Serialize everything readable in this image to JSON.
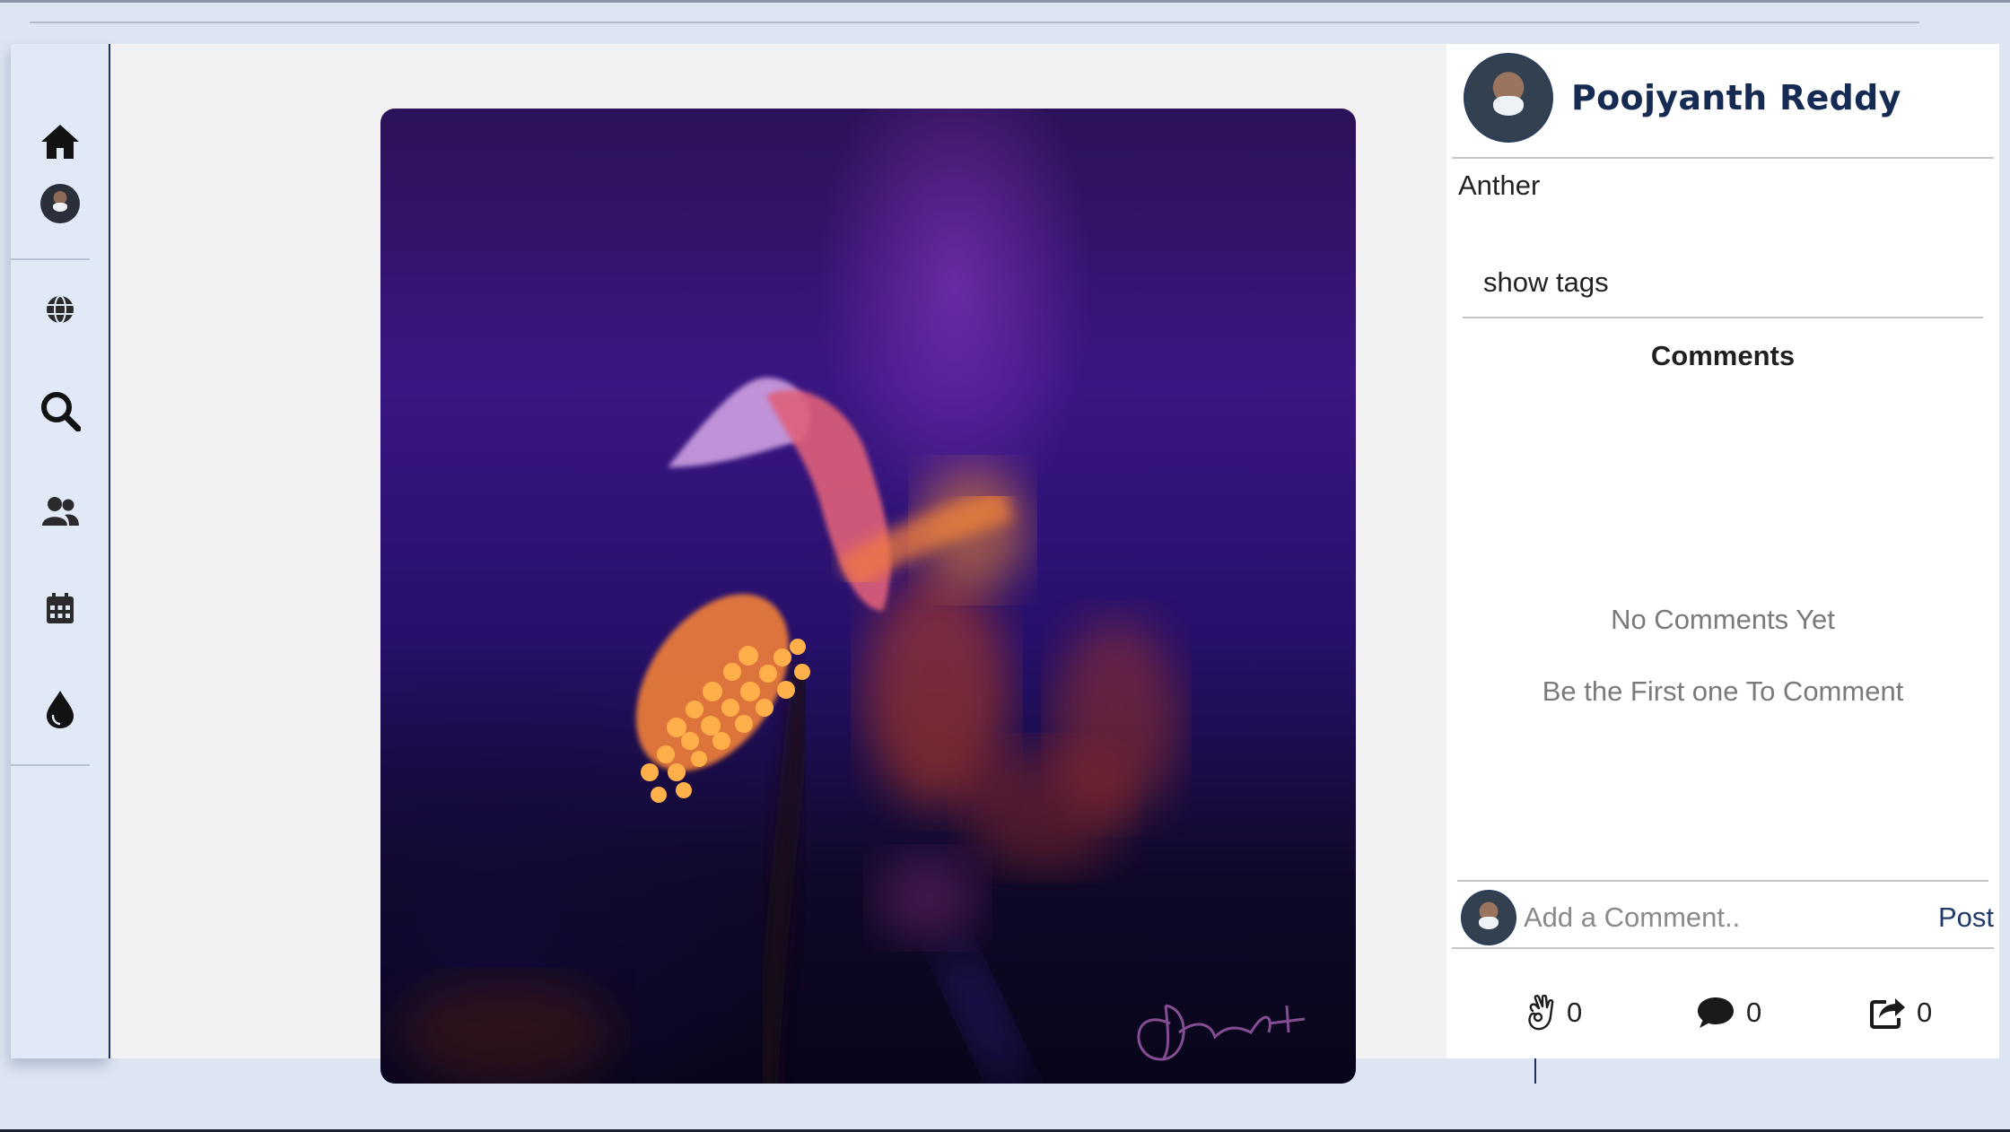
{
  "sidebar": {
    "items": [
      {
        "name": "home",
        "icon": "home-icon"
      },
      {
        "name": "profile",
        "icon": "user-avatar"
      },
      {
        "name": "explore",
        "icon": "globe-icon"
      },
      {
        "name": "search",
        "icon": "search-icon"
      },
      {
        "name": "people",
        "icon": "users-icon"
      },
      {
        "name": "calendar",
        "icon": "calendar-icon"
      },
      {
        "name": "theme",
        "icon": "drop-icon"
      }
    ]
  },
  "post": {
    "image_description": "macro photo of a flower anther with orange pollen on a purple background",
    "author": "Poojyanth Reddy",
    "caption": "Anther",
    "show_tags_label": "show tags"
  },
  "comments": {
    "title": "Comments",
    "empty_title": "No Comments Yet",
    "empty_subtitle": "Be the First one To Comment",
    "input_placeholder": "Add a Comment..",
    "post_label": "Post"
  },
  "stats": {
    "likes": "0",
    "comments": "0",
    "shares": "0"
  },
  "colors": {
    "accent": "#162b54",
    "page_bg": "#dde4f2",
    "sidebar_bg": "#e1e8f6"
  }
}
